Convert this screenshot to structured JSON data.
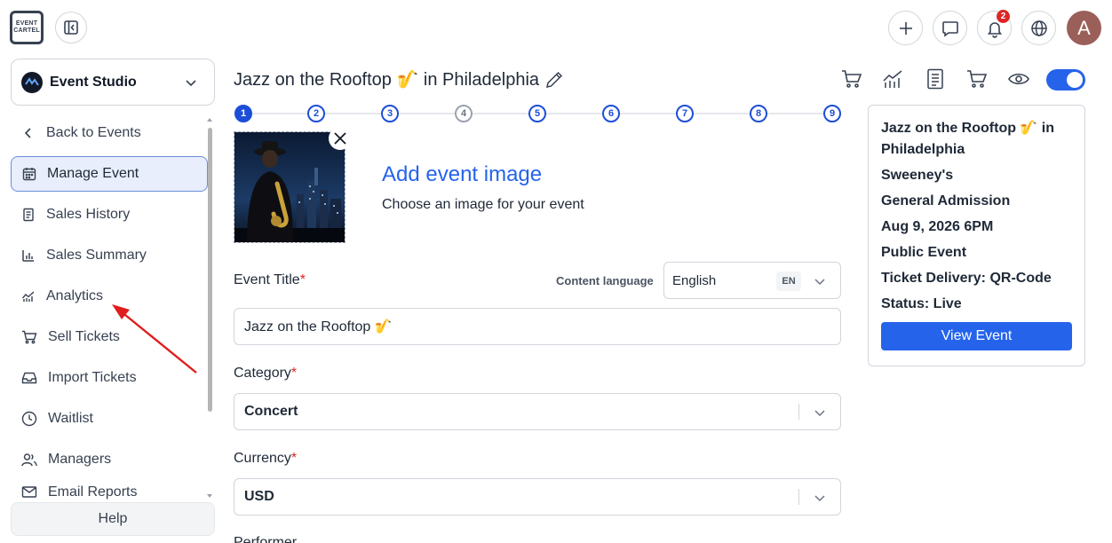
{
  "app": {
    "logo_line1": "EVENT",
    "logo_line2": "CARTEL",
    "notifications_count": "2",
    "avatar_initial": "A"
  },
  "sidebar": {
    "studio_label": "Event Studio",
    "items": [
      {
        "label": "Back to Events",
        "icon": "chevron-left-icon"
      },
      {
        "label": "Manage Event",
        "icon": "calendar-icon",
        "active": true
      },
      {
        "label": "Sales History",
        "icon": "receipt-icon"
      },
      {
        "label": "Sales Summary",
        "icon": "bar-chart-icon"
      },
      {
        "label": "Analytics",
        "icon": "line-chart-icon"
      },
      {
        "label": "Sell Tickets",
        "icon": "cart-icon"
      },
      {
        "label": "Import Tickets",
        "icon": "inbox-icon"
      },
      {
        "label": "Waitlist",
        "icon": "clock-icon"
      },
      {
        "label": "Managers",
        "icon": "users-icon"
      },
      {
        "label": "Email Reports",
        "icon": "mail-icon"
      }
    ],
    "help_label": "Help"
  },
  "main": {
    "title": "Jazz on the Rooftop 🎷 in Philadelphia",
    "steps": [
      "1",
      "2",
      "3",
      "4",
      "5",
      "6",
      "7",
      "8",
      "9"
    ],
    "add_image_title": "Add event image",
    "add_image_subtitle": "Choose an image for your event",
    "event_title_label": "Event Title",
    "content_language_label": "Content language",
    "language_value": "English",
    "language_code": "EN",
    "event_title_value": "Jazz on the Rooftop 🎷",
    "category_label": "Category",
    "category_value": "Concert",
    "currency_label": "Currency",
    "currency_value": "USD",
    "performer_label": "Performer",
    "required_mark": "*"
  },
  "summary": {
    "title": "Jazz on the Rooftop 🎷 in Philadelphia",
    "venue": "Sweeney's",
    "ticket_type": "General Admission",
    "date": "Aug 9, 2026 6PM",
    "visibility": "Public Event",
    "delivery": "Ticket Delivery: QR-Code",
    "status": "Status: Live",
    "view_button": "View Event"
  },
  "colors": {
    "accent": "#2563eb",
    "required": "#dc2626",
    "annotation_arrow": "#e11d1d"
  }
}
